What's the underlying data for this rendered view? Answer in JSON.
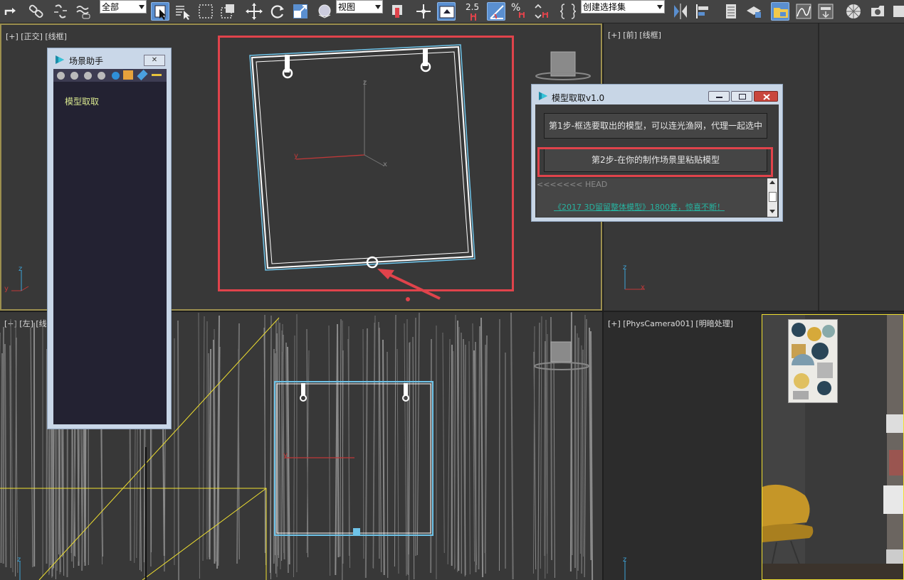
{
  "toolbar": {
    "selection_filter": "全部",
    "ref_coord": "视图",
    "angle_snap": "2.5",
    "percent_snap_label": "%",
    "selection_set_placeholder": "创建选择集",
    "icons": [
      "redo-icon",
      "link-icon",
      "unlink-icon",
      "bind-spacewarp-icon",
      "select-object-icon",
      "select-by-name-icon",
      "rect-selection-icon",
      "window-crossing-icon",
      "move-icon",
      "rotate-icon",
      "scale-icon",
      "place-icon",
      "mirror-icon",
      "align-icon",
      "layer-icon",
      "ribbon-icon",
      "curve-editor-icon",
      "schematic-icon",
      "material-editor-icon",
      "render-setup-icon",
      "render-frame-icon",
      "render-icon"
    ]
  },
  "viewports": {
    "top_left": {
      "label": "[+] [正交] [线框]"
    },
    "top_right": {
      "label": "[+] [前] [线框]"
    },
    "bottom_left": {
      "label": "[+] [左] [线"
    },
    "bottom_right": {
      "label": "[+] [PhysCamera001] [明暗处理]"
    }
  },
  "axis": {
    "x": "x",
    "y": "y",
    "z": "z"
  },
  "assistant_panel": {
    "title": "场景助手",
    "close_label": "✕",
    "items": [
      "模型取取"
    ]
  },
  "extract_dialog": {
    "title": "模型取取v1.0",
    "step1": "第1步-框选要取出的模型，可以连光渔网，代理一起选中",
    "step2": "第2步-在你的制作场景里粘贴模型",
    "log_line": "<<<<<<< HEAD",
    "promo_link": "《2017 3D留留整体模型》1800套，惊喜不断！"
  },
  "colors": {
    "highlight": "#e0434b",
    "selection": "#6ec3e8",
    "viewport_bg": "#383838",
    "grid": "#8a8a8a",
    "camera_frame": "#f0e030"
  }
}
